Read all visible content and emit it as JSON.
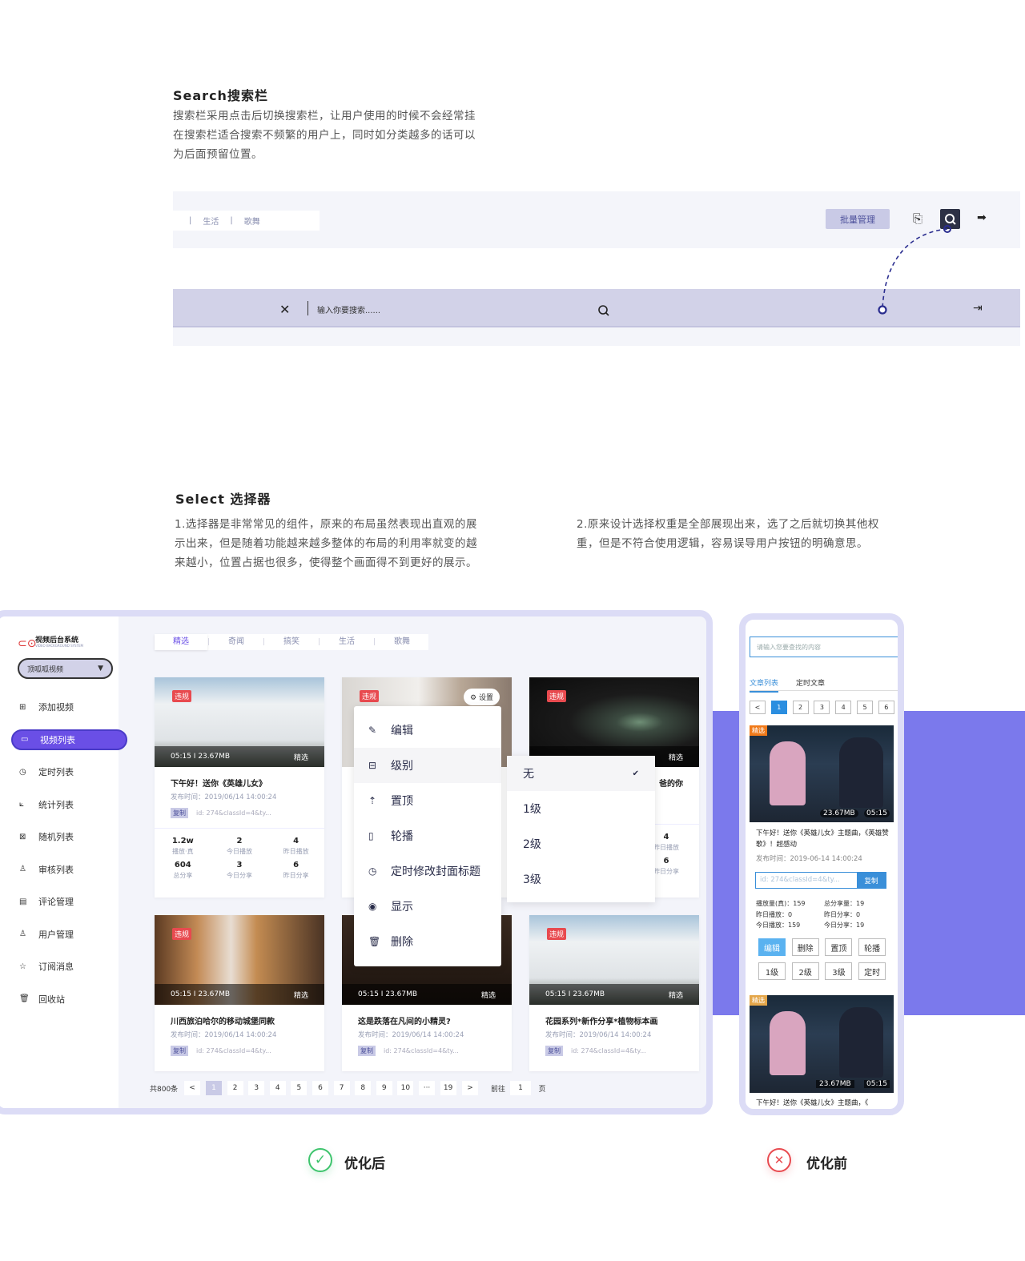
{
  "search_section": {
    "title": "Search搜索栏",
    "lines": [
      "搜索栏采用点击后切换搜索栏，让用户使用的时候不会经常挂",
      "在搜索栏适合搜索不频繁的用户上，同时如分类越多的话可以",
      "为后面预留位置。"
    ],
    "tabs": [
      "生活",
      "歌舞"
    ],
    "batch_button": "批量管理",
    "search_placeholder": "输入你要搜索......"
  },
  "select_section": {
    "title": "Select 选择器",
    "left": [
      "1.选择器是非常常见的组件，原来的布局虽然表现出直观的展",
      "示出来，但是随着功能越来越多整体的布局的利用率就变的越",
      "来越小，位置占据也很多，使得整个画面得不到更好的展示。"
    ],
    "right": [
      "2.原来设计选择权重是全部展现出来，选了之后就切换其他权",
      "重，但是不符合使用逻辑，容易误导用户按钮的明确意思。"
    ]
  },
  "app": {
    "logo_title": "视频后台系统",
    "logo_sub": "VIDEO BACKGROUND SYSTEM",
    "dropdown": "顶呱呱视频",
    "nav": [
      {
        "label": "添加视频",
        "icon": "add-video-icon",
        "glyph": "⊞"
      },
      {
        "label": "视频列表",
        "icon": "video-list-icon",
        "glyph": "▭",
        "active": true
      },
      {
        "label": "定时列表",
        "icon": "clock-icon",
        "glyph": "◷"
      },
      {
        "label": "统计列表",
        "icon": "chart-icon",
        "glyph": "⟀"
      },
      {
        "label": "随机列表",
        "icon": "random-icon",
        "glyph": "⊠"
      },
      {
        "label": "审核列表",
        "icon": "review-icon",
        "glyph": "♙"
      },
      {
        "label": "评论管理",
        "icon": "comment-icon",
        "glyph": "▤"
      },
      {
        "label": "用户管理",
        "icon": "user-icon",
        "glyph": "♙"
      },
      {
        "label": "订阅消息",
        "icon": "star-icon",
        "glyph": "☆"
      },
      {
        "label": "回收站",
        "icon": "trash-icon",
        "glyph": "🗑"
      }
    ],
    "cat_tabs": [
      "精选",
      "奇闻",
      "搞笑",
      "生活",
      "歌舞"
    ],
    "cards": [
      {
        "badge": "违规",
        "meta": "05:15 I 23.67MB",
        "tag": "精选",
        "title": "下午好！送你《英雄儿女》",
        "date": "发布时间：2019/06/14 14:00:24",
        "copy": "复制",
        "id": "id: 274&classId=4&ty...",
        "stats": [
          [
            "1.2w",
            "播放·真"
          ],
          [
            "2",
            "今日播放"
          ],
          [
            "4",
            "昨日播放"
          ],
          [
            "604",
            "总分享"
          ],
          [
            "3",
            "今日分享"
          ],
          [
            "6",
            "昨日分享"
          ]
        ],
        "img": "house"
      },
      {
        "badge": "违规",
        "settings": "设置",
        "img": "wall"
      },
      {
        "badge": "违规",
        "tag": "精选",
        "title": "爸的你",
        "stats": [
          [
            "4",
            "昨日播放"
          ],
          [
            "6",
            "昨日分享"
          ]
        ],
        "img": "eye"
      },
      {
        "badge": "违规",
        "meta": "05:15 I 23.67MB",
        "tag": "精选",
        "title": "川西旅泊哈尔的移动城堡同款",
        "date": "发布时间：2019/06/14 14:00:24",
        "copy": "复制",
        "id": "id: 274&classId=4&ty...",
        "img": "temple"
      },
      {
        "meta": "05:15 I 23.67MB",
        "tag": "精选",
        "title": "这是跌落在凡间的小精灵?",
        "date": "发布时间：2019/06/14 14:00:24",
        "copy": "复制",
        "id": "id: 274&classId=4&ty...",
        "img": "dark"
      },
      {
        "badge": "违规",
        "meta": "05:15 I 23.67MB",
        "tag": "精选",
        "title": "花园系列*新作分享*植物标本画",
        "date": "发布时间：2019/06/14 14:00:24",
        "copy": "复制",
        "id": "id: 274&classId=4&ty...",
        "img": "house"
      }
    ],
    "menu": [
      "编辑",
      "级别",
      "置顶",
      "轮播",
      "定时修改封面标题",
      "显示",
      "删除"
    ],
    "levels": [
      "无",
      "1级",
      "2级",
      "3级"
    ],
    "selected_level": "无",
    "pagination": {
      "total": "共800条",
      "pages": [
        "1",
        "2",
        "3",
        "4",
        "5",
        "6",
        "7",
        "8",
        "9",
        "10",
        "···",
        "19"
      ],
      "current": "1",
      "goto": "前往",
      "goto_value": "1",
      "page_unit": "页"
    }
  },
  "old": {
    "placeholder": "请输入您要查找的内容",
    "tabs": [
      "文章列表",
      "定时文章"
    ],
    "pages": [
      "<",
      "1",
      "2",
      "3",
      "4",
      "5",
      "6"
    ],
    "badge": "精选",
    "size": "23.67MB",
    "duration": "05:15",
    "title": "下午好！送你《英雄儿女》主题曲，《英雄赞歌》！超感动",
    "date": "发布时间：2019-06-14 14:00:24",
    "id": "id: 274&classId=4&ty...",
    "copy": "复制",
    "stats": [
      "播放量(真)：159",
      "总分享量：19",
      "昨日播放：0",
      "昨日分享：0",
      "今日播放：159",
      "今日分享：19"
    ],
    "buttons": [
      "编辑",
      "删除",
      "置顶",
      "轮播",
      "1级",
      "2级",
      "3级",
      "定时"
    ],
    "title2": "下午好！送你《英雄儿女》主题曲，《"
  },
  "labels": {
    "after": "优化后",
    "before": "优化前"
  },
  "colors": {
    "accent": "#6a4fe6",
    "lavender": "#c9cae6",
    "band": "#7b79ec",
    "danger": "#e84a4f",
    "success": "#3ec46d"
  }
}
